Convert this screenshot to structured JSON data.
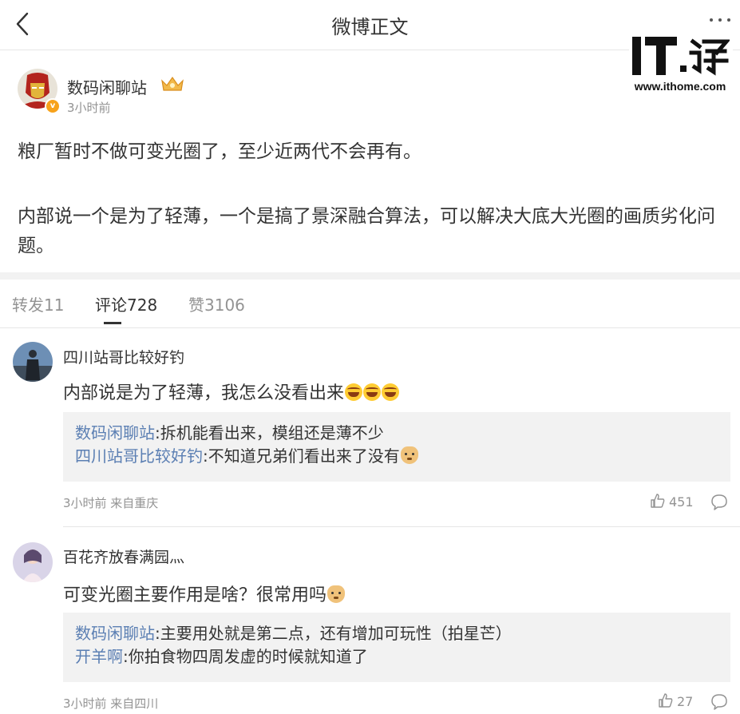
{
  "header": {
    "title": "微博正文"
  },
  "watermark": {
    "logo_text": "IT之家",
    "url": "www.ithome.com"
  },
  "post": {
    "author": "数码闲聊站",
    "time": "3小时前",
    "paragraphs": [
      "粮厂暂时不做可变光圈了，至少近两代不会再有。",
      "内部说一个是为了轻薄，一个是搞了景深融合算法，可以解决大底大光圈的画质劣化问题。"
    ]
  },
  "tabs": [
    {
      "label": "转发11"
    },
    {
      "label": "评论728"
    },
    {
      "label": "赞3106"
    }
  ],
  "comments": [
    {
      "user": "四川站哥比较好钓",
      "text": "内部说是为了轻薄，我怎么没看出来",
      "replies": [
        {
          "user": "数码闲聊站",
          "text": ":拆机能看出来，模组还是薄不少"
        },
        {
          "user": "四川站哥比较好钓",
          "text": ":不知道兄弟们看出来了没有"
        }
      ],
      "meta": "3小时前 来自重庆",
      "likes": "451"
    },
    {
      "user": "百花齐放春满园灬",
      "text": "可变光圈主要作用是啥？很常用吗",
      "replies": [
        {
          "user": "数码闲聊站",
          "text": ":主要用处就是第二点，还有增加可玩性（拍星芒）"
        },
        {
          "user": "开羊啊",
          "text": ":你拍食物四周发虚的时候就知道了"
        }
      ],
      "meta": "3小时前 来自四川",
      "likes": "27"
    }
  ],
  "colors": {
    "link": "#5b7fb3",
    "muted": "#939393",
    "text": "#333333",
    "reply_bg": "#f2f2f2"
  }
}
